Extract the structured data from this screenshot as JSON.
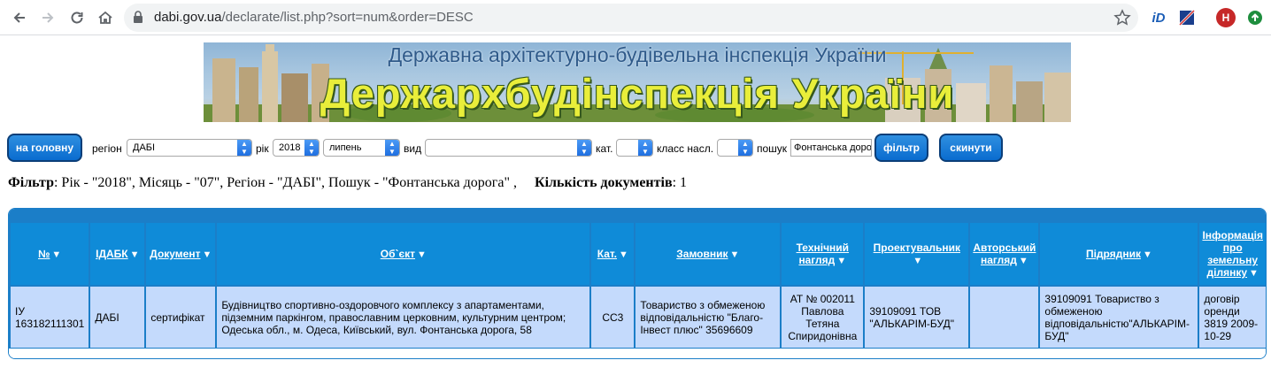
{
  "browser": {
    "url_host": "dabi.gov.ua",
    "url_path": "/declarate/list.php?sort=num&order=DESC",
    "profile_initial": "H",
    "ext_id_label": "iD"
  },
  "banner": {
    "top_line": "Державна архітектурно-будівельна інспекція України",
    "main_line": "Держархбудінспекція України"
  },
  "filters": {
    "home_button": "на головну",
    "region_label": "регіон",
    "region_value": "ДАБІ",
    "year_label": "рік",
    "year_value": "2018",
    "month_value": "липень",
    "type_label": "вид",
    "type_value": "",
    "cat_label": "кат.",
    "cat_value": "",
    "class_label": "класс насл.",
    "class_value": "",
    "search_label": "пошук",
    "search_value": "Фонтанська дорога",
    "filter_button": "фільтр",
    "reset_button": "скинути"
  },
  "summary": {
    "filter_label": "Фільтр",
    "filter_text": ": Рік - \"2018\", Місяць - \"07\", Регіон - \"ДАБІ\", Пошук - \"Фонтанська дорога\" ,",
    "count_label": "Кількість документів",
    "count_value": ": 1"
  },
  "table": {
    "headers": [
      "№",
      "ІДАБК",
      "Документ",
      "Об`єкт",
      "Кат.",
      "Замовник",
      "Технічний нагляд",
      "Проектувальник",
      "Авторський нагляд",
      "Підрядник",
      "Інформація про земельну ділянку"
    ],
    "sort_glyph": "▼",
    "row": {
      "num": "ІУ 163182111301",
      "idabk": "ДАБІ",
      "document": "сертифікат",
      "object": "Будівництво спортивно-оздоровчого комплексу з апартаментами, підземним паркінгом, православним церковним, культурним центром; Одеська обл., м. Одеса, Київський, вул. Фонтанська дорога, 58",
      "cat": "СС3",
      "customer": "Товариство з обмеженою відповідальністю \"Благо-Інвест плюс\" 35696609",
      "tech_supervision": "АТ № 002011 Павлова Тетяна Спиридонівна",
      "designer": "39109091 ТОВ \"АЛЬКАРІМ-БУД\"",
      "author_supervision": "",
      "contractor": "39109091 Товариство з обмеженою відповідальністю\"АЛЬКАРІМ-БУД\"",
      "land_info": "договір оренди 3819 2009-10-29"
    }
  },
  "colors": {
    "table_blue": "#1b7ec8",
    "header_blue": "#0f8bd8",
    "cell_blue": "#c4dafc",
    "button_blue": "#0a6ccf"
  }
}
